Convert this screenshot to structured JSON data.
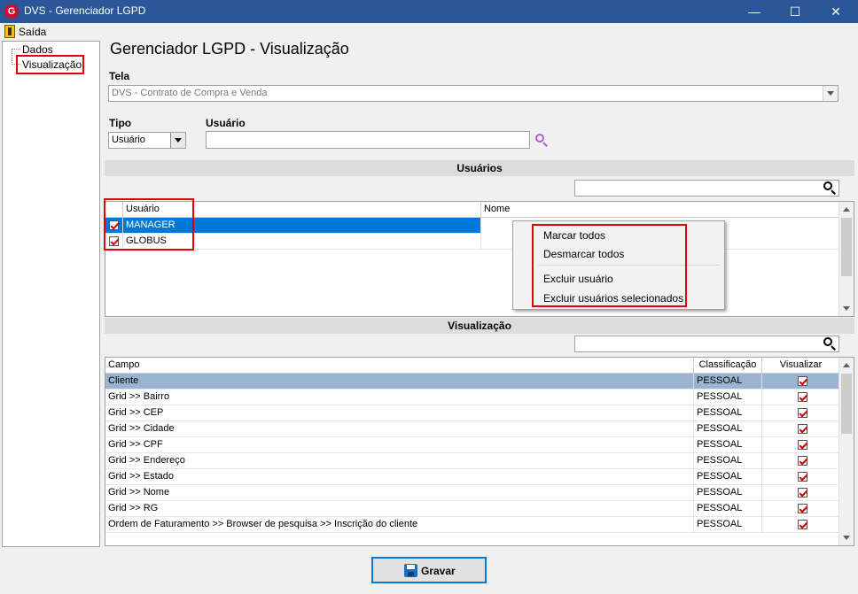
{
  "window": {
    "icon": "app-logo-icon",
    "title": "DVS - Gerenciador LGPD",
    "minimize_glyph": "—",
    "maximize_glyph": "☐",
    "close_glyph": "✕"
  },
  "menu": {
    "exit_label": "Saída",
    "exit_icon": "exit-door-icon"
  },
  "tree": {
    "items": [
      {
        "label": "Dados"
      },
      {
        "label": "Visualização"
      }
    ]
  },
  "page": {
    "title": "Gerenciador LGPD - Visualização"
  },
  "tela": {
    "label": "Tela",
    "value": "DVS - Contrato de Compra e Venda"
  },
  "tipo": {
    "label": "Tipo",
    "value": "Usuário"
  },
  "usuario": {
    "label": "Usuário",
    "value": "",
    "search_icon": "search-icon"
  },
  "users_section": {
    "header": "Usuários",
    "filter_value": "",
    "columns": {
      "user": "Usuário",
      "name": "Nome"
    },
    "rows": [
      {
        "user": "MANAGER",
        "name": "",
        "checked": true,
        "selected": true
      },
      {
        "user": "GLOBUS",
        "name": "",
        "checked": true,
        "selected": false
      }
    ]
  },
  "context_menu": {
    "items": [
      "Marcar todos",
      "Desmarcar todos",
      "Excluir usuário",
      "Excluir usuários selecionados"
    ]
  },
  "view_section": {
    "header": "Visualização",
    "filter_value": "",
    "columns": {
      "field": "Campo",
      "class": "Classificação",
      "visible": "Visualizar"
    },
    "rows": [
      {
        "field": "Cliente",
        "class": "PESSOAL",
        "visible": true
      },
      {
        "field": "Grid >> Bairro",
        "class": "PESSOAL",
        "visible": true
      },
      {
        "field": "Grid >> CEP",
        "class": "PESSOAL",
        "visible": true
      },
      {
        "field": "Grid >> Cidade",
        "class": "PESSOAL",
        "visible": true
      },
      {
        "field": "Grid >> CPF",
        "class": "PESSOAL",
        "visible": true
      },
      {
        "field": "Grid >> Endereço",
        "class": "PESSOAL",
        "visible": true
      },
      {
        "field": "Grid >> Estado",
        "class": "PESSOAL",
        "visible": true
      },
      {
        "field": "Grid >> Nome",
        "class": "PESSOAL",
        "visible": true
      },
      {
        "field": "Grid >> RG",
        "class": "PESSOAL",
        "visible": true
      },
      {
        "field": "Ordem de Faturamento >> Browser de pesquisa >> Inscrição do cliente",
        "class": "PESSOAL",
        "visible": true
      }
    ]
  },
  "save_button": {
    "label": "Gravar",
    "icon": "save-disk-icon"
  },
  "colors": {
    "titlebar": "#2b579a",
    "selection_blue": "#0078d7",
    "selection_light": "#99b4d1",
    "highlight_red": "#e00000"
  }
}
